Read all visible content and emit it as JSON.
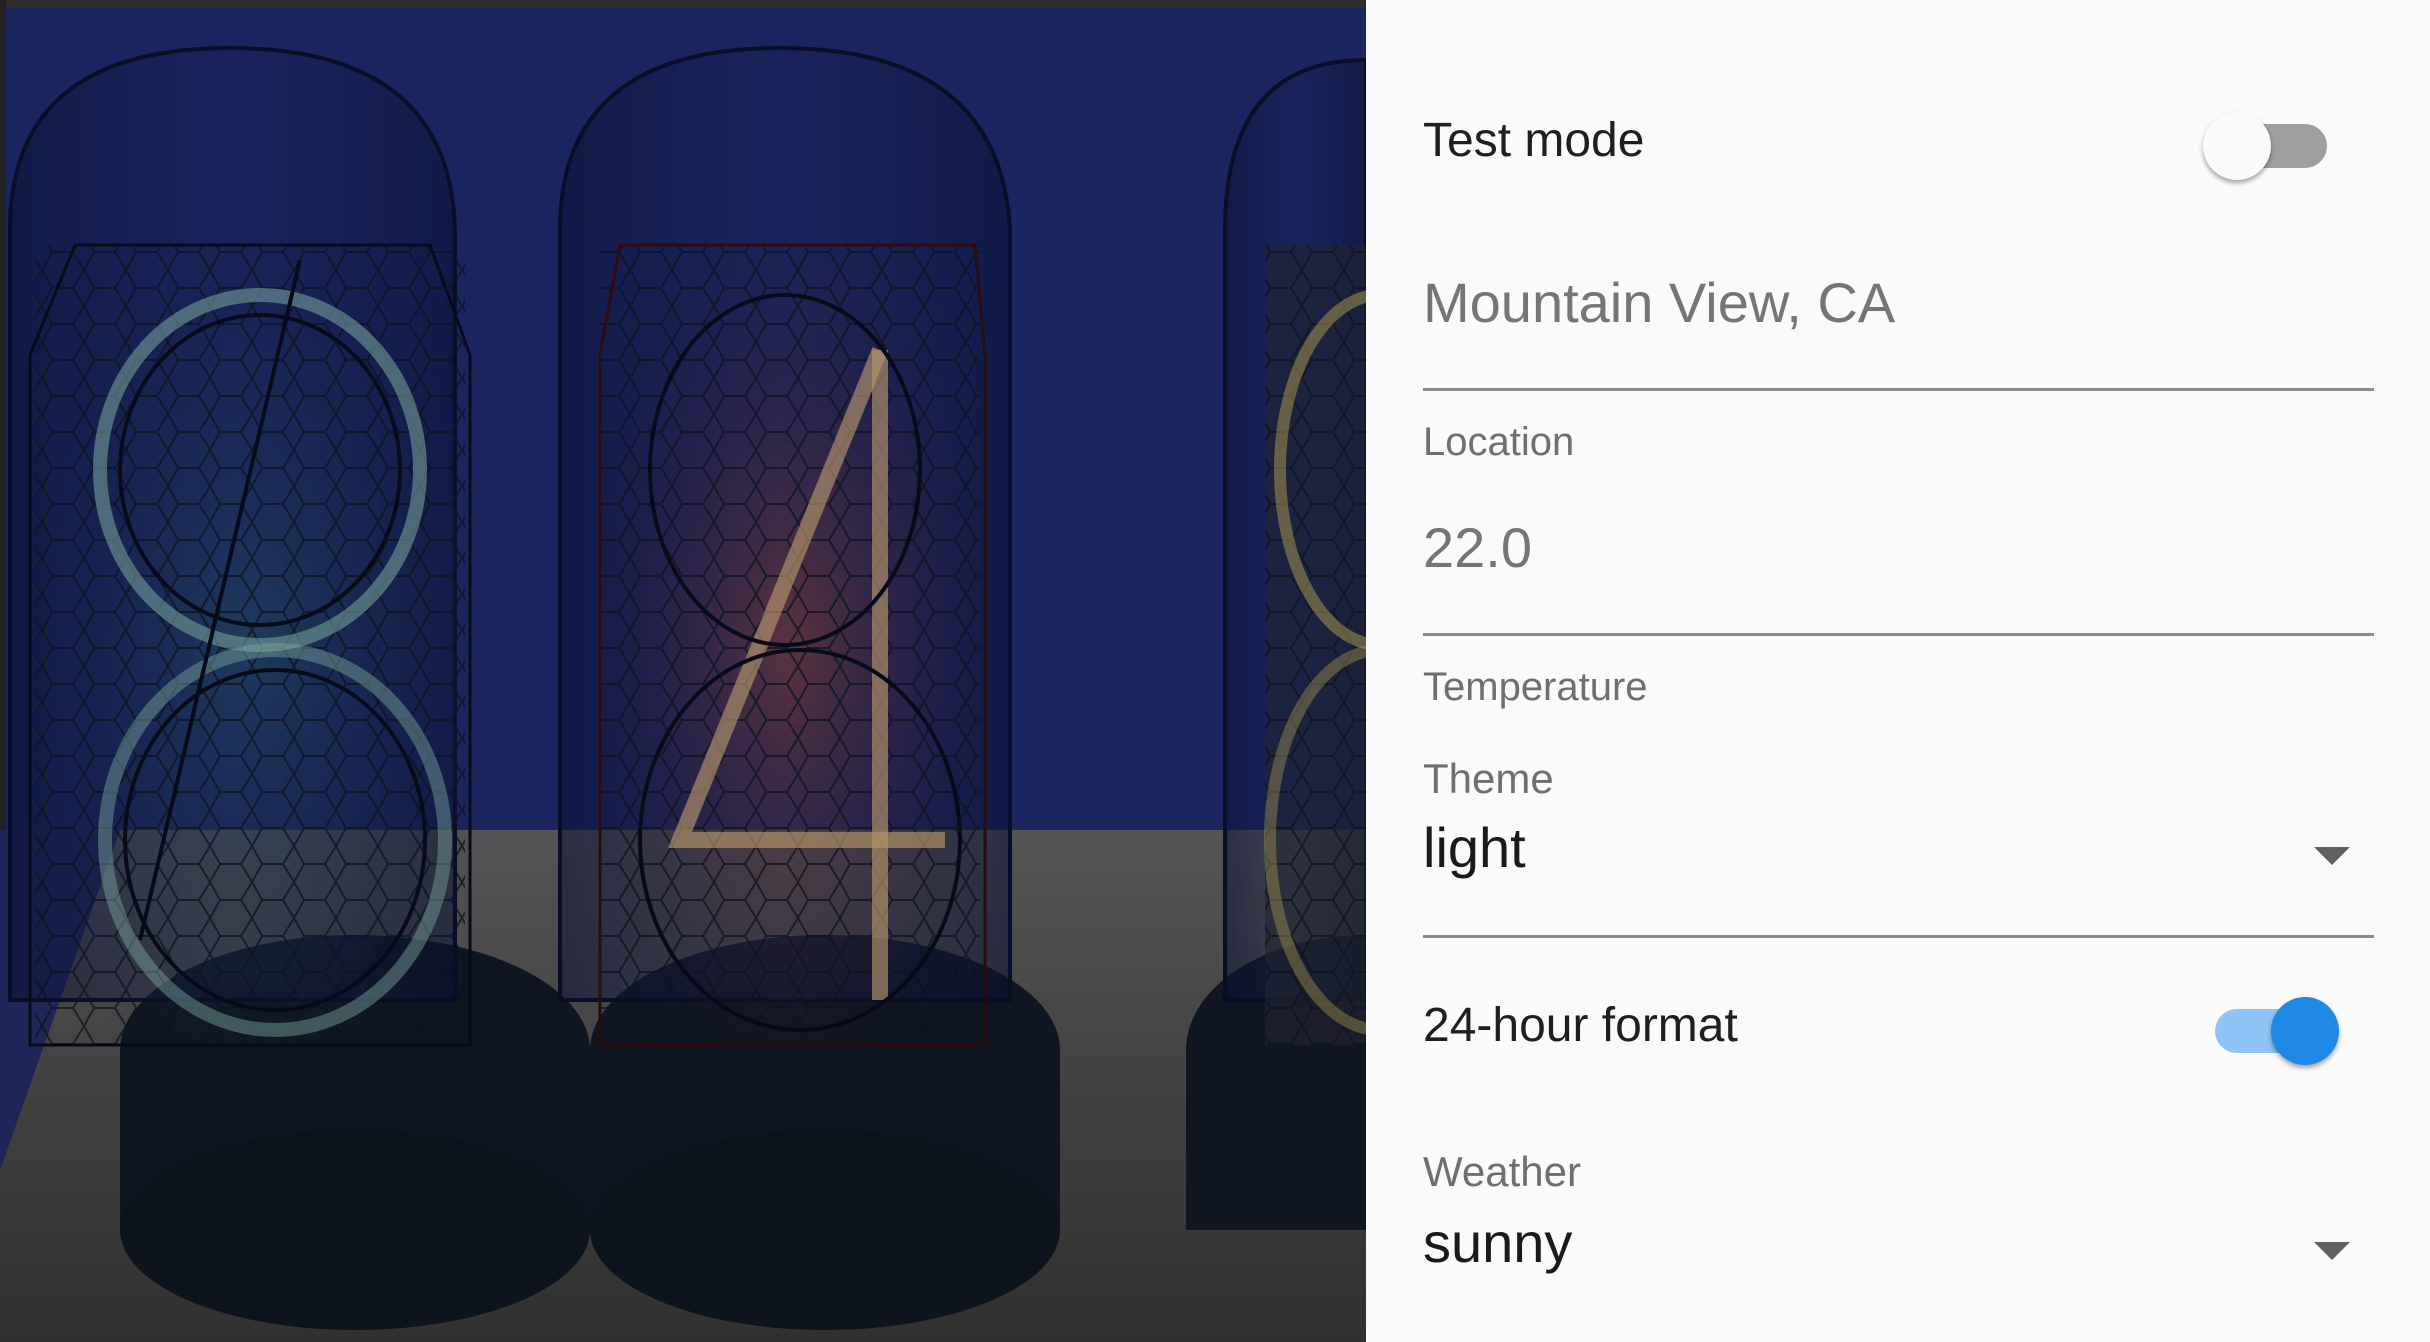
{
  "settings": {
    "test_mode": {
      "label": "Test mode",
      "enabled": false
    },
    "location": {
      "value": "Mountain View, CA",
      "helper": "Location"
    },
    "temperature": {
      "value": "22.0",
      "helper": "Temperature"
    },
    "theme": {
      "label": "Theme",
      "selected": "light"
    },
    "hour_format": {
      "label": "24-hour format",
      "enabled": true
    },
    "weather": {
      "label": "Weather",
      "selected": "sunny"
    }
  },
  "colors": {
    "accent": "#1e88e5",
    "accent_track": "#90c4f6",
    "tube_left_glow": "#8fd3c8",
    "tube_middle_glow": "#e8c08a",
    "tube_right_glow": "#e2c96a",
    "backdrop": "#1b2a6a"
  }
}
